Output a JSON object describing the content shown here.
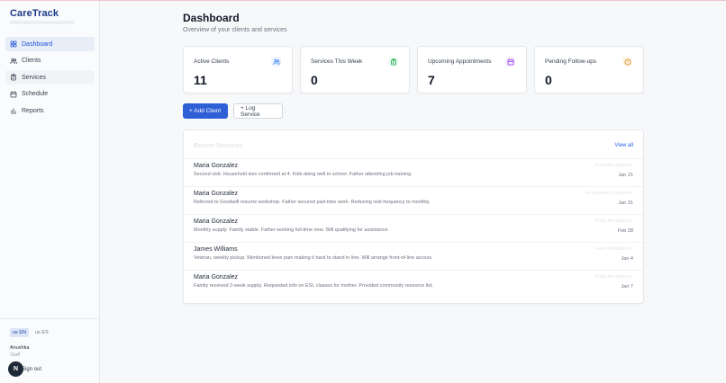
{
  "brand": {
    "name": "CareTrack"
  },
  "nav": {
    "items": [
      {
        "label": "Dashboard",
        "icon": "dashboard-icon"
      },
      {
        "label": "Clients",
        "icon": "users-icon"
      },
      {
        "label": "Services",
        "icon": "clipboard-icon"
      },
      {
        "label": "Schedule",
        "icon": "calendar-icon"
      },
      {
        "label": "Reports",
        "icon": "bar-chart-icon"
      }
    ]
  },
  "footer": {
    "lang_en": "us EN",
    "lang_es": "us ES",
    "user_name": "Anushka",
    "user_role": "Staff",
    "avatar_letter": "N",
    "signout_label": "Sign out"
  },
  "header": {
    "title": "Dashboard",
    "subtitle": "Overview of your clients and services"
  },
  "stats": [
    {
      "label": "Active Clients",
      "value": "11",
      "icon": "users-icon",
      "color": "#3b82f6",
      "bg": "#eef3fd"
    },
    {
      "label": "Services This Week",
      "value": "0",
      "icon": "clipboard-icon",
      "color": "#16a34a",
      "bg": "#ecfdf3"
    },
    {
      "label": "Upcoming Appointments",
      "value": "7",
      "icon": "calendar-icon",
      "color": "#9333ea",
      "bg": "#f5effd"
    },
    {
      "label": "Pending Follow-ups",
      "value": "0",
      "icon": "alert-circle-icon",
      "color": "#d97706",
      "bg": "#fef7e8"
    }
  ],
  "actions": {
    "add_client": "+ Add Client",
    "log_service": "+ Log Service"
  },
  "recent": {
    "title": "Recent Services",
    "view_all": "View all",
    "rows": [
      {
        "name": "Maria Gonzalez",
        "note": "Second visit. Household size confirmed at 4. Kids doing well in school. Father attending job training.",
        "type": "Food Assistance",
        "date": "Jan 21"
      },
      {
        "name": "Maria Gonzalez",
        "note": "Referred to Goodwill resume workshop. Father secured part-time work. Reducing visit frequency to monthly.",
        "type": "Employment Support",
        "date": "Jan 31"
      },
      {
        "name": "Maria Gonzalez",
        "note": "Monthly supply. Family stable. Father working full-time now. Still qualifying for assistance.",
        "type": "Food Assistance",
        "date": "Feb 28"
      },
      {
        "name": "James Williams",
        "note": "Veteran, weekly pickup. Mentioned knee pain making it hard to stand in line. Will arrange front-of-line access.",
        "type": "Food Assistance",
        "date": "Jan 4"
      },
      {
        "name": "Maria Gonzalez",
        "note": "Family received 2-week supply. Requested info on ESL classes for mother. Provided community resource list.",
        "type": "Food Assistance",
        "date": "Jan 7"
      }
    ]
  },
  "colors": {
    "accent": "#2f5fd6",
    "brand": "#1e3a8a"
  }
}
